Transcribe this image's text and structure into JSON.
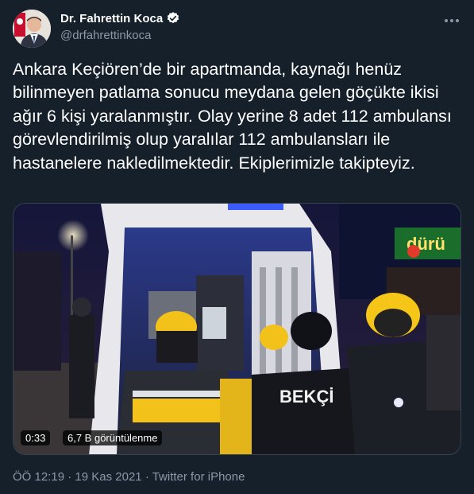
{
  "author": {
    "name": "Dr. Fahrettin Koca",
    "handle": "@drfahrettinkoca",
    "verified_icon": "verified-badge-icon"
  },
  "tweet": {
    "text": "Ankara Keçiören’de bir apartmanda, kaynağı henüz bilinmeyen patlama sonucu meydana gelen göçükte ikisi ağır 6 kişi yaralanmıştır. Olay yerine 8 adet 112 ambulansı görevlendirilmiş olup yaralılar 112 ambulansları ile hastanelere nakledilmektedir. Ekiplerimizle takipteyiz."
  },
  "video": {
    "duration": "0:33",
    "views": "6,7 B görüntülenme",
    "sign_text": "dürü",
    "vest_text": "BEKÇİ"
  },
  "footer": {
    "time": "ÖÖ 12:19",
    "separator": "·",
    "date": "19 Kas 2021",
    "source": "Twitter for iPhone"
  },
  "colors": {
    "background": "#15202b",
    "secondary_text": "#8b98a5",
    "verified": "#ffffff"
  }
}
